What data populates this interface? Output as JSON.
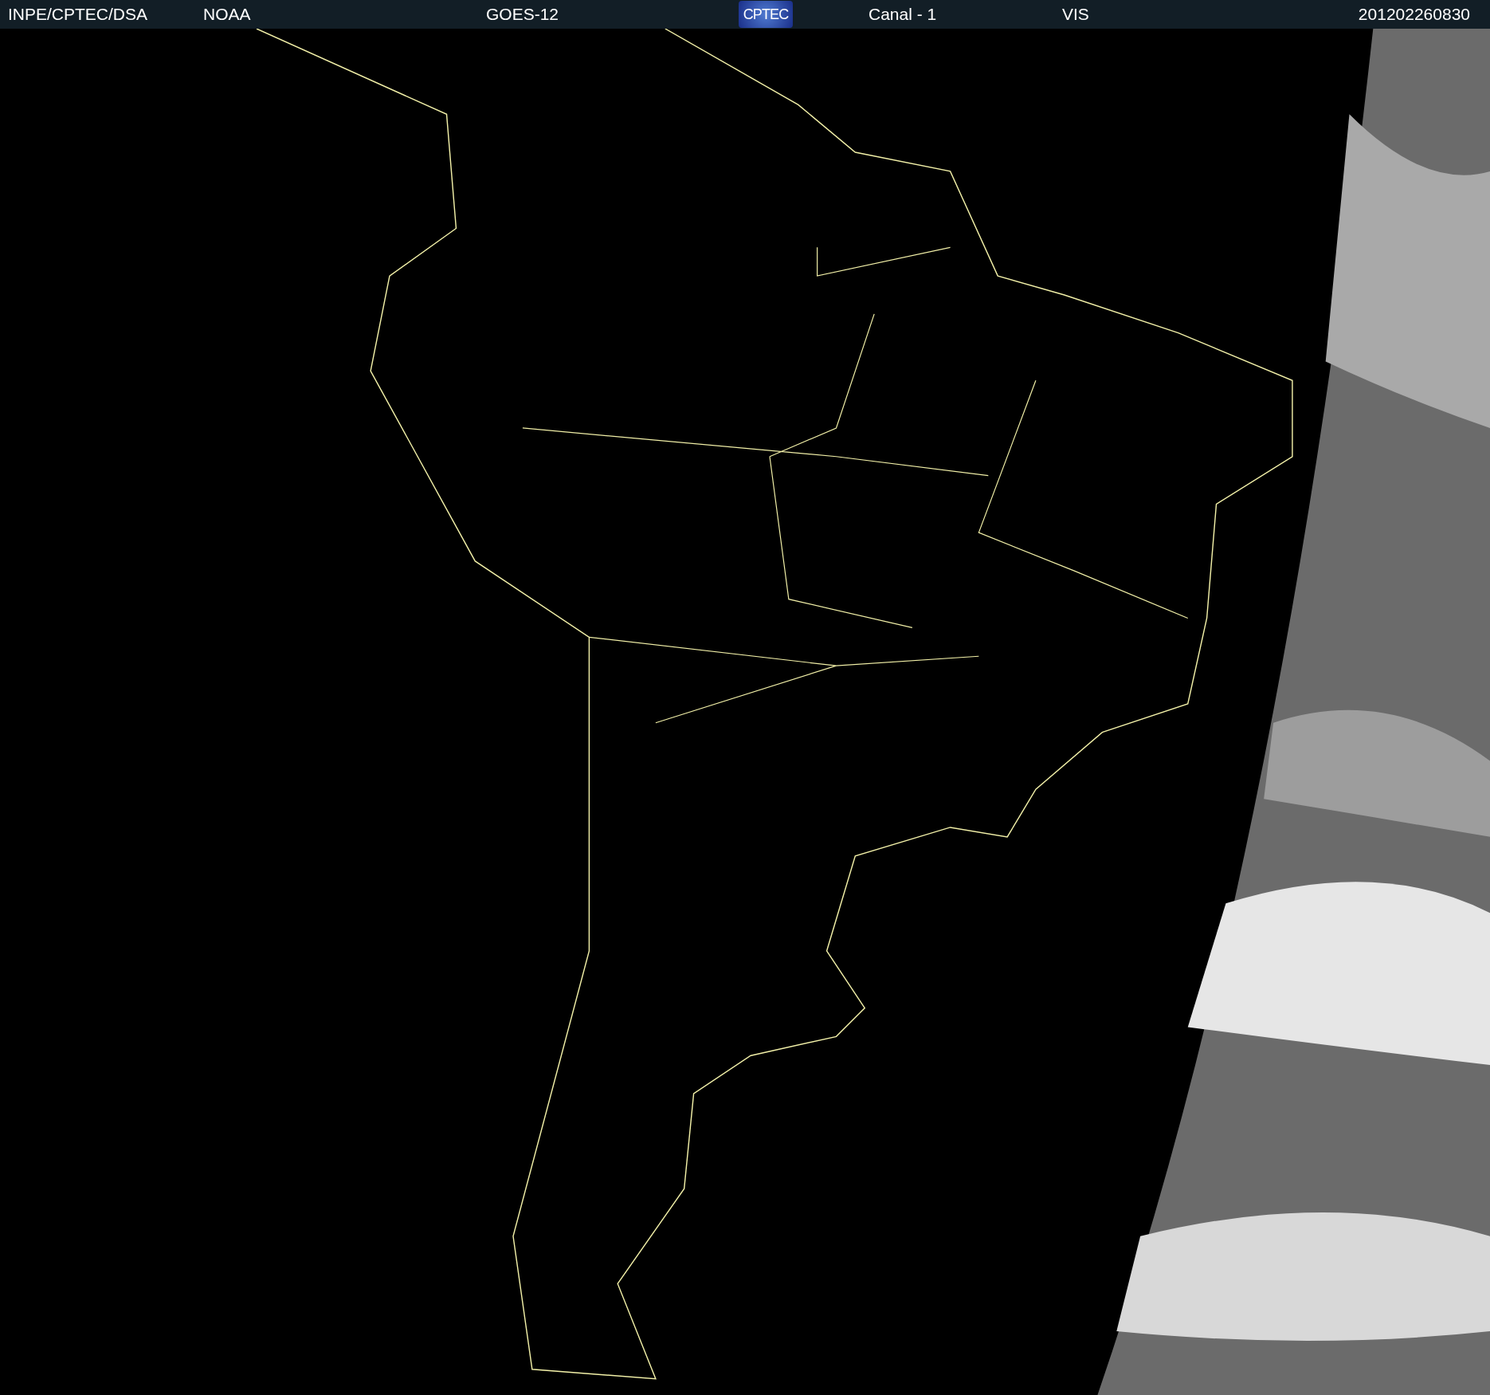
{
  "header": {
    "items": [
      {
        "kind": "text",
        "text": "INPE/CPTEC/DSA"
      },
      {
        "kind": "text",
        "text": "NOAA"
      },
      {
        "kind": "text",
        "text": "GOES-12"
      },
      {
        "kind": "logo",
        "text": "CPTEC"
      },
      {
        "kind": "text",
        "text": "Canal - 1"
      },
      {
        "kind": "text",
        "text": "VIS"
      },
      {
        "kind": "text",
        "text": "201202260830"
      }
    ]
  }
}
